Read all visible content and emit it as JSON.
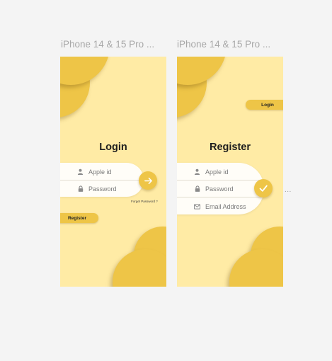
{
  "frames": [
    {
      "title": "iPhone 14 & 15 Pro ...",
      "heading": "Login",
      "fields": [
        {
          "icon": "user-icon",
          "placeholder": "Apple id"
        },
        {
          "icon": "lock-icon",
          "placeholder": "Password"
        }
      ],
      "forgot_link": "Forget Password ?",
      "submit_icon": "arrow-right-icon",
      "switch_button": "Register"
    },
    {
      "title": "iPhone 14 & 15 Pro ...",
      "heading": "Register",
      "fields": [
        {
          "icon": "user-icon",
          "placeholder": "Apple id"
        },
        {
          "icon": "lock-icon",
          "placeholder": "Password"
        },
        {
          "icon": "mail-icon",
          "placeholder": "Email Address"
        }
      ],
      "submit_icon": "checkmark-icon",
      "switch_button": "Login"
    }
  ],
  "more_indicator": "...",
  "colors": {
    "canvas": "#f4f4f4",
    "frame_bg": "#ffeba5",
    "accent": "#eec547",
    "field_bg": "#fffdf8"
  }
}
